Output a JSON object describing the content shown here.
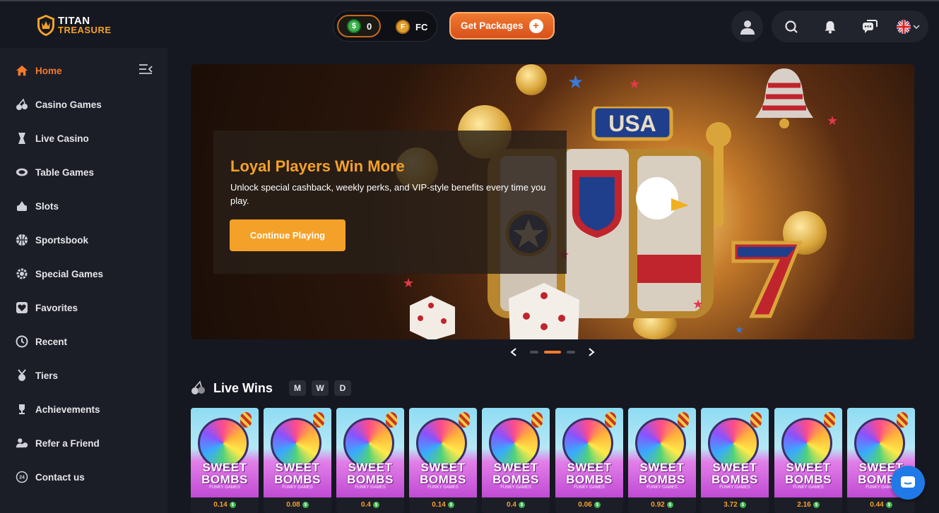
{
  "brand": {
    "line1": "TITAN",
    "line2": "TREASURE"
  },
  "wallet": {
    "sc_balance": "0",
    "sc_icon": "sweeps-coin-icon",
    "fc_label": "FC",
    "fc_icon": "fortune-coin-icon"
  },
  "header": {
    "get_packages_label": "Get Packages",
    "language": "en-GB"
  },
  "sidebar": {
    "items": [
      {
        "label": "Home",
        "icon": "home-icon",
        "active": true
      },
      {
        "label": "Casino Games",
        "icon": "cherries-icon"
      },
      {
        "label": "Live Casino",
        "icon": "card-icon"
      },
      {
        "label": "Table Games",
        "icon": "table-icon"
      },
      {
        "label": "Slots",
        "icon": "slot-icon"
      },
      {
        "label": "Sportsbook",
        "icon": "basketball-icon"
      },
      {
        "label": "Special Games",
        "icon": "gear-icon"
      },
      {
        "label": "Favorites",
        "icon": "heart-icon"
      },
      {
        "label": "Recent",
        "icon": "clock-icon"
      },
      {
        "label": "Tiers",
        "icon": "medal-icon"
      },
      {
        "label": "Achievements",
        "icon": "trophy-icon"
      },
      {
        "label": "Refer a Friend",
        "icon": "users-icon"
      },
      {
        "label": "Contact us",
        "icon": "support-24-icon"
      }
    ]
  },
  "banner": {
    "title": "Loyal Players Win More",
    "subtitle": "Unlock special cashback, weekly perks, and VIP-style benefits every time you play.",
    "button_label": "Continue Playing",
    "sign_text": "USA",
    "slides": 3,
    "active_slide": 2
  },
  "live_wins": {
    "title": "Live Wins",
    "filters": [
      "M",
      "W",
      "D"
    ],
    "game_title_1": "SWEET",
    "game_title_2": "BOMBS",
    "game_maker": "FUNKY GAMES",
    "wins": [
      "0.14",
      "0.08",
      "0.4",
      "0.14",
      "0.4",
      "0.06",
      "0.92",
      "3.72",
      "2.16",
      "0.44"
    ]
  },
  "colors": {
    "accent": "#f57a2a",
    "gold": "#f4a12a",
    "bg": "#161821",
    "sidebar": "#1c1e27",
    "chat": "#1f7ae8"
  }
}
